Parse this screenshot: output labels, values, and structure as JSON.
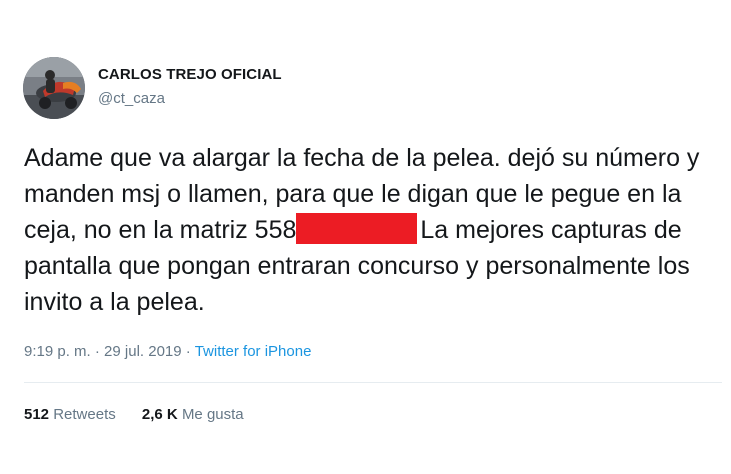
{
  "user": {
    "display_name": "CARLOS TREJO OFICIAL",
    "handle": "@ct_caza",
    "avatar_icon": "profile-photo-motorcycle"
  },
  "tweet": {
    "text_before_redaction": "Adame que va alargar la fecha de la pelea. dejó su número y manden msj o llamen, para que le digan que le pegue en la ceja, no en la matriz 558",
    "redaction_color": "#ec1c24",
    "text_after_redaction": "La mejores capturas de pantalla que pongan entraran concurso y personalmente los invito a la pelea."
  },
  "meta": {
    "time": "9:19 p. m.",
    "separator": "·",
    "date": "29 jul. 2019",
    "source": "Twitter for iPhone"
  },
  "stats": {
    "retweets_count": "512",
    "retweets_label": "Retweets",
    "likes_count": "2,6 K",
    "likes_label": "Me gusta"
  },
  "colors": {
    "text": "#14171a",
    "secondary": "#657786",
    "link": "#1b95e0",
    "divider": "#e6ecf0"
  }
}
